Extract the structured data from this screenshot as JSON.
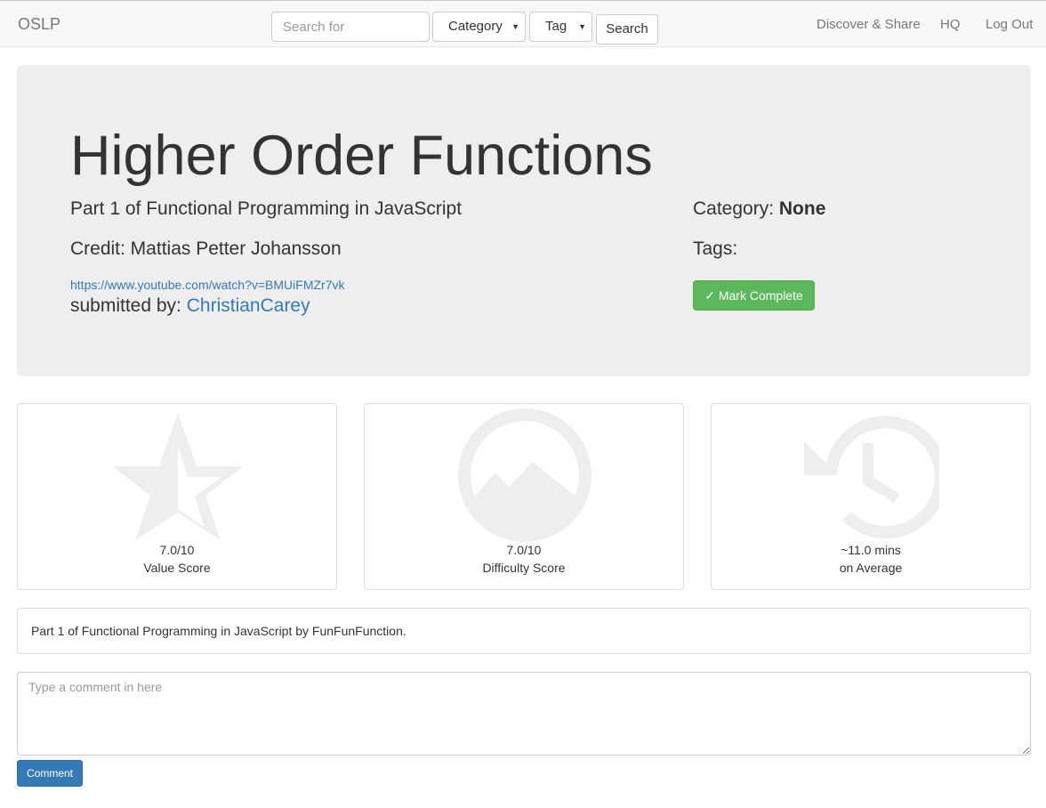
{
  "navbar": {
    "brand": "OSLP",
    "search_placeholder": "Search for",
    "category_select": "Category",
    "tag_select": "Tag",
    "search_button": "Search",
    "links": [
      "Discover & Share",
      "HQ",
      "Log Out"
    ]
  },
  "resource": {
    "title": "Higher Order Functions",
    "subtitle": "Part 1 of Functional Programming in JavaScript",
    "credit": "Credit: Mattias Petter Johansson",
    "url": "https://www.youtube.com/watch?v=BMUiFMZr7vk",
    "submitted_label": "submitted by: ",
    "submitted_by": "ChristianCarey",
    "category_label": "Category: ",
    "category_value": "None",
    "tags_label": "Tags:",
    "mark_complete": "✓ Mark Complete"
  },
  "scores": [
    {
      "icon": "star-half-icon",
      "value": "7.0/10",
      "label": "Value Score"
    },
    {
      "icon": "mountain-icon",
      "value": "7.0/10",
      "label": "Difficulty Score"
    },
    {
      "icon": "history-icon",
      "value": "~11.0 mins",
      "label": "on Average"
    }
  ],
  "description": "Part 1 of Functional Programming in JavaScript by FunFunFunction.",
  "comment": {
    "placeholder": "Type a comment in here",
    "button": "Comment"
  },
  "colors": {
    "accent": "#337ab7",
    "success": "#5cb85c",
    "jumbotron": "#eeeeee",
    "icon": "#eeeeee"
  }
}
